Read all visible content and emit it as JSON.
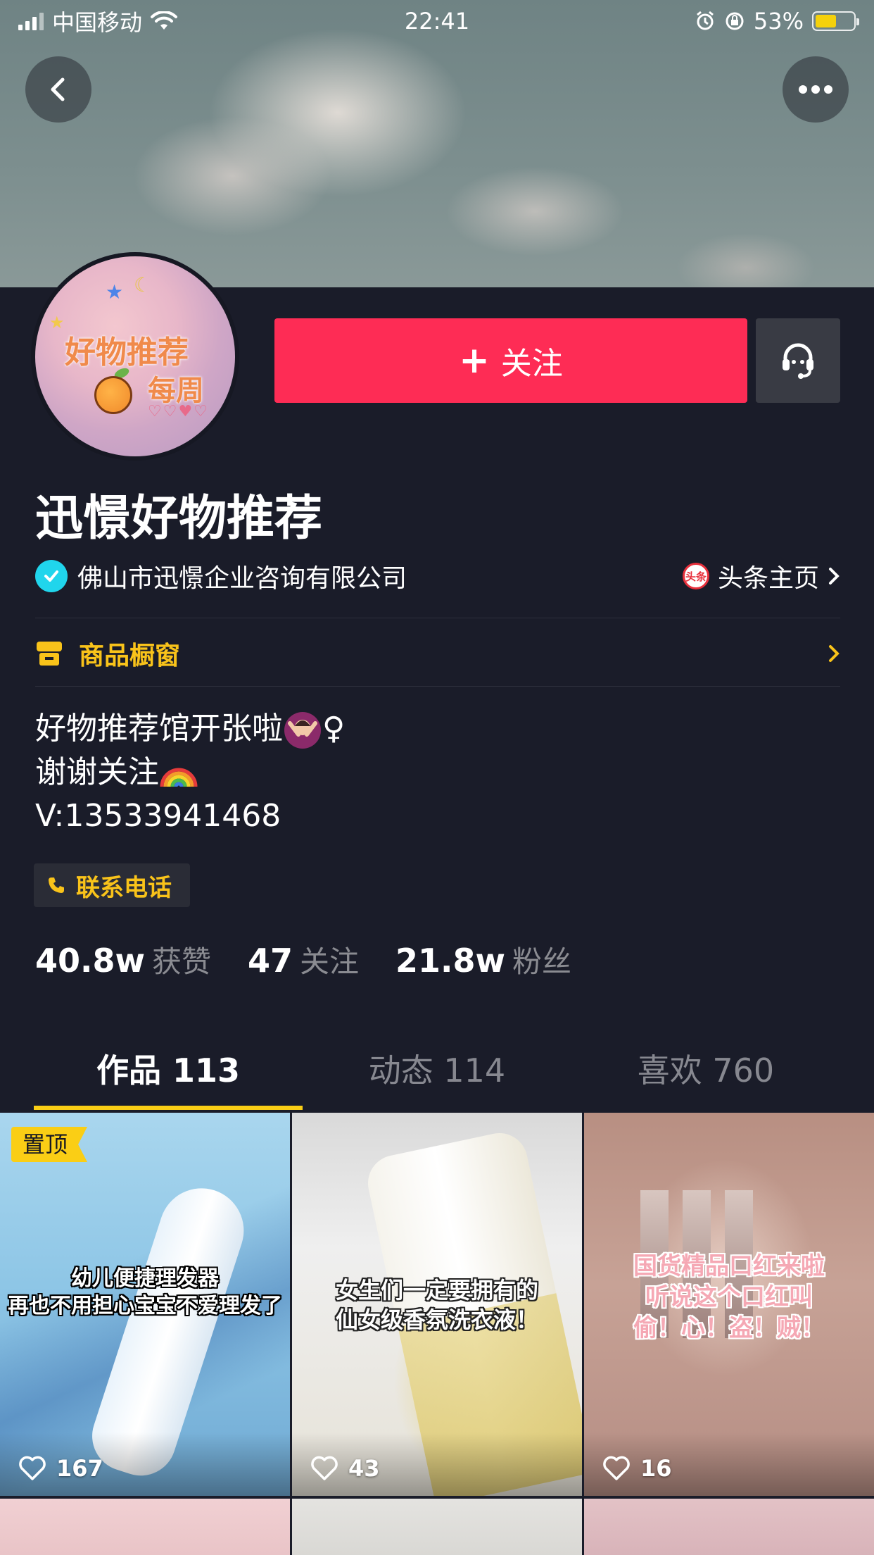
{
  "status_bar": {
    "carrier": "中国移动",
    "time": "22:41",
    "battery": "53%"
  },
  "profile": {
    "avatar_text_line1": "好物推荐",
    "avatar_text_line2": "每周",
    "follow_label": "关注",
    "name": "迅憬好物推荐",
    "company": "佛山市迅憬企业咨询有限公司",
    "toutiao_logo_text": "头条",
    "toutiao_link": "头条主页",
    "shop_label": "商品橱窗",
    "bio": {
      "line1": "好物推荐馆开张啦",
      "line1_suffix": "♀",
      "line2": "谢谢关注",
      "line3": "V:13533941468"
    },
    "phone_label": "联系电话"
  },
  "stats": [
    {
      "value": "40.8w",
      "label": "获赞"
    },
    {
      "value": "47",
      "label": "关注"
    },
    {
      "value": "21.8w",
      "label": "粉丝"
    }
  ],
  "tabs": [
    {
      "label": "作品 113",
      "active": true
    },
    {
      "label": "动态 114",
      "active": false
    },
    {
      "label": "喜欢 760",
      "active": false
    }
  ],
  "videos": [
    {
      "pinned_label": "置顶",
      "caption_line1": "幼儿便捷理发器",
      "caption_line2": "再也不用担心宝宝不爱理发了",
      "likes": "167"
    },
    {
      "caption_line1": "女生们一定要拥有的",
      "caption_line2": "仙女级香氛洗衣液！",
      "likes": "43"
    },
    {
      "caption_line1": "国货精品口红来啦",
      "caption_line2": "听说这个口红叫",
      "caption_line3": "偷！心！盗！贼！",
      "likes": "16"
    }
  ],
  "colors": {
    "background": "#161823",
    "follow_button": "#fe2c55",
    "accent_yellow": "#face15",
    "verify_blue": "#20d5ec"
  },
  "icons": {
    "back": "chevron-left-icon",
    "more": "more-horizontal-icon",
    "customer_service": "headset-icon",
    "verified": "check-badge-icon",
    "shop": "shop-icon",
    "phone": "phone-icon",
    "like": "heart-outline-icon"
  }
}
